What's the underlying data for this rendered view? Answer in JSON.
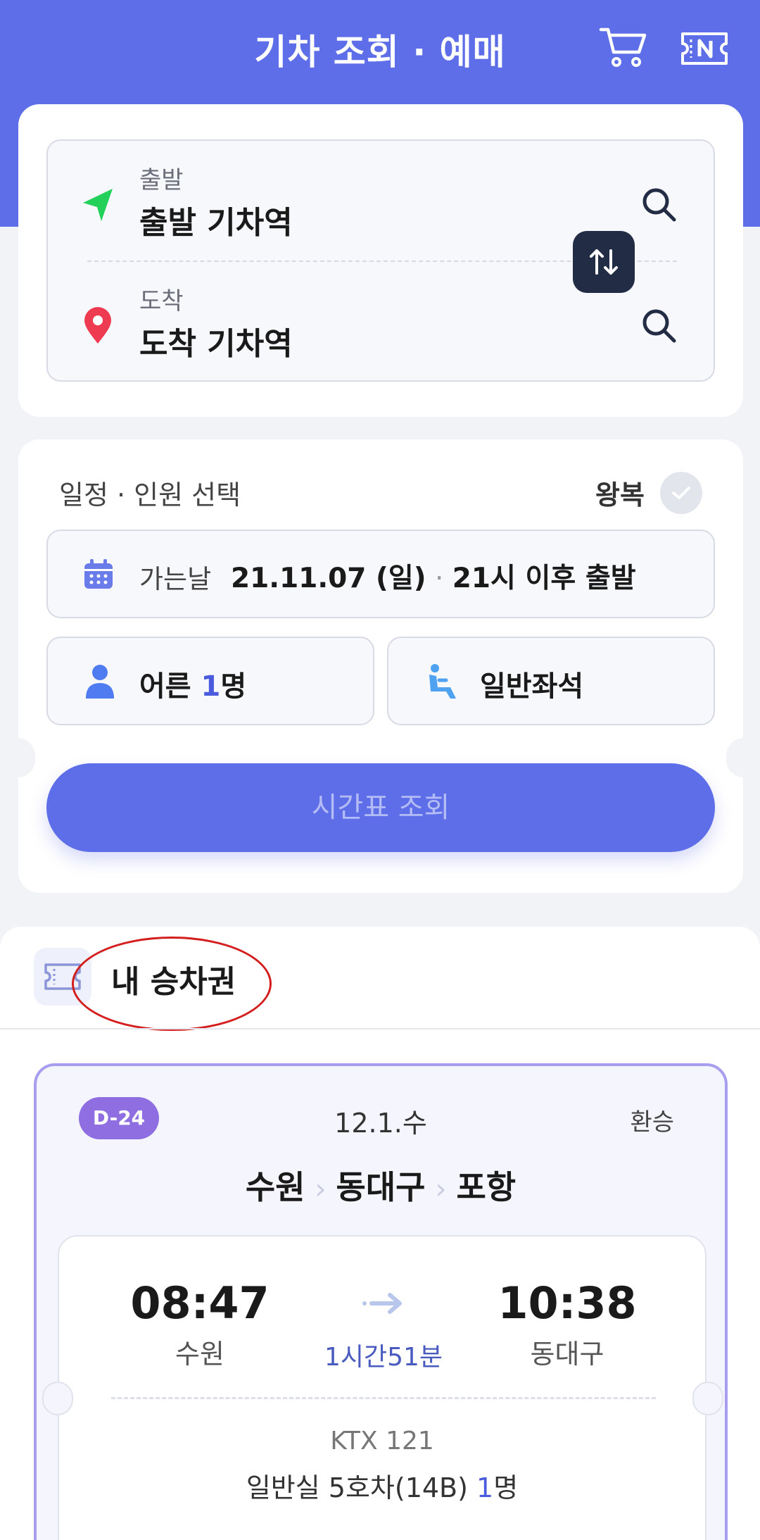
{
  "header": {
    "title": "기차 조회 · 예매",
    "cart_icon": "cart-icon",
    "ticket_icon": "ticket-n-icon",
    "bg_color": "#5e6ee8"
  },
  "route": {
    "departure": {
      "label": "출발",
      "value": "출발 기차역",
      "icon": "navigation-arrow-icon"
    },
    "arrival": {
      "label": "도착",
      "value": "도착 기차역",
      "icon": "location-pin-icon"
    },
    "swap_icon": "swap-arrows-icon"
  },
  "schedule": {
    "title": "일정 · 인원 선택",
    "roundtrip_label": "왕복",
    "date_label": "가는날",
    "date_value": "21.11.07 (일)",
    "time_value": "21시 이후 출발",
    "passenger_prefix": "어른 ",
    "passenger_count": "1",
    "passenger_suffix": "명",
    "seat_type": "일반좌석",
    "submit_label": "시간표 조회"
  },
  "my_tickets": {
    "title": "내 승차권",
    "ticket": {
      "dday": "D-24",
      "date": "12.1.수",
      "transfer_label": "환승",
      "route_stops": [
        "수원",
        "동대구",
        "포항"
      ],
      "departure_time": "08:47",
      "departure_station": "수원",
      "arrival_time": "10:38",
      "arrival_station": "동대구",
      "duration": "1시간51분",
      "train": "KTX 121",
      "seat_info": "일반실 5호차(14B) ",
      "passenger_count": "1",
      "passenger_suffix": "명"
    }
  },
  "colors": {
    "accent": "#5e6ee8",
    "badge": "#8e6ee0",
    "highlight": "#d41e1e"
  }
}
